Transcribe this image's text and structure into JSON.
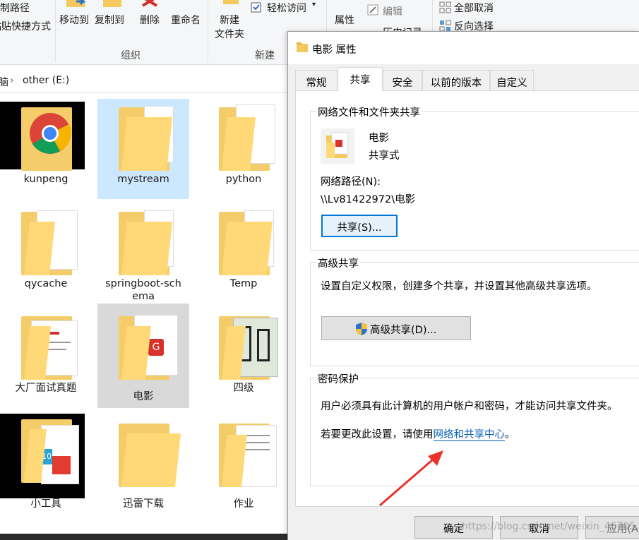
{
  "ribbon": {
    "copy_path": "制路径",
    "paste_shortcut": "粘贴快捷方式",
    "move_to": "移动到",
    "copy_to": "复制到",
    "delete": "删除",
    "rename": "重命名",
    "new_folder": "新建\n文件夹",
    "new_folder_1": "新建",
    "new_folder_2": "文件夹",
    "easy_access": "轻松访问",
    "properties": "属性",
    "edit": "编辑",
    "history": "历史记录",
    "select_none": "全部取消",
    "invert_selection": "反向选择",
    "group_organize": "组织",
    "group_new": "新建"
  },
  "address": {
    "prev": "脑",
    "current": "other (E:)"
  },
  "files": [
    {
      "name": "kunpeng"
    },
    {
      "name": "mystream"
    },
    {
      "name": "python"
    },
    {
      "name": "qycache"
    },
    {
      "name": "springboot-sch",
      "name2": "ema"
    },
    {
      "name": "Temp"
    },
    {
      "name": "大厂面试真题"
    },
    {
      "name": "电影"
    },
    {
      "name": "四级"
    },
    {
      "name": "小工具"
    },
    {
      "name": "迅雷下载"
    },
    {
      "name": "作业"
    }
  ],
  "dialog": {
    "title": "电影 属性",
    "tabs": [
      "常规",
      "共享",
      "安全",
      "以前的版本",
      "自定义"
    ],
    "active_tab": "共享",
    "net_share_legend": "网络文件和文件夹共享",
    "folder_name": "电影",
    "share_state": "共享式",
    "net_path_label": "网络路径(N):",
    "net_path": "\\\\Lv81422972\\电影",
    "share_button": "共享(S)...",
    "adv_legend": "高级共享",
    "adv_desc": "设置自定义权限，创建多个共享，并设置其他高级共享选项。",
    "adv_button": "高级共享(D)...",
    "pwd_legend": "密码保护",
    "pwd_desc": "用户必须具有此计算机的用户帐户和密码，才能访问共享文件夹。",
    "pwd_change_prefix": "若要更改此设置，请使用",
    "pwd_link": "网络和共享中心",
    "pwd_change_suffix": "。",
    "ok": "确定",
    "cancel": "取消",
    "apply": "应用(A)"
  },
  "watermark": "https://blog.csdn.net/weixin_46705..."
}
